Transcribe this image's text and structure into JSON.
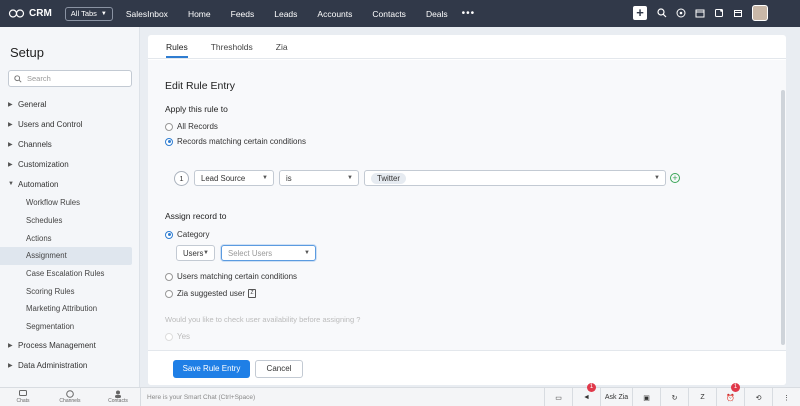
{
  "topbar": {
    "brand": "CRM",
    "all_tabs": "All Tabs",
    "nav": [
      "SalesInbox",
      "Home",
      "Feeds",
      "Leads",
      "Accounts",
      "Contacts",
      "Deals"
    ],
    "more": "•••"
  },
  "sidebar": {
    "title": "Setup",
    "search_placeholder": "Search",
    "groups": [
      {
        "label": "General"
      },
      {
        "label": "Users and Control"
      },
      {
        "label": "Channels"
      },
      {
        "label": "Customization"
      },
      {
        "label": "Automation"
      }
    ],
    "automation_items": [
      "Workflow Rules",
      "Schedules",
      "Actions",
      "Assignment",
      "Case Escalation Rules",
      "Scoring Rules",
      "Marketing Attribution",
      "Segmentation"
    ],
    "after_groups": [
      "Process Management",
      "Data Administration"
    ]
  },
  "tabs": [
    "Rules",
    "Thresholds",
    "Zia"
  ],
  "form": {
    "title": "Edit Rule Entry",
    "apply_label": "Apply this rule to",
    "apply_options": [
      "All Records",
      "Records matching certain conditions"
    ],
    "condition": {
      "index": "1",
      "field": "Lead Source",
      "operator": "is",
      "value": "Twitter"
    },
    "assign_label": "Assign record to",
    "assign_options": {
      "category": "Category",
      "users_matching": "Users matching certain conditions",
      "zia": "Zia suggested user"
    },
    "category_select": "Users",
    "users_placeholder": "Select Users",
    "availability_question": "Would you like to check user availability before assigning ?",
    "yes_label": "Yes"
  },
  "footer": {
    "save": "Save Rule Entry",
    "cancel": "Cancel"
  },
  "bottombar": {
    "left": [
      "Chats",
      "Channels",
      "Contacts"
    ],
    "smartchat": "Here is your Smart Chat (Ctrl+Space)",
    "ask_zia": "Ask Zia",
    "badge_count": "1"
  }
}
